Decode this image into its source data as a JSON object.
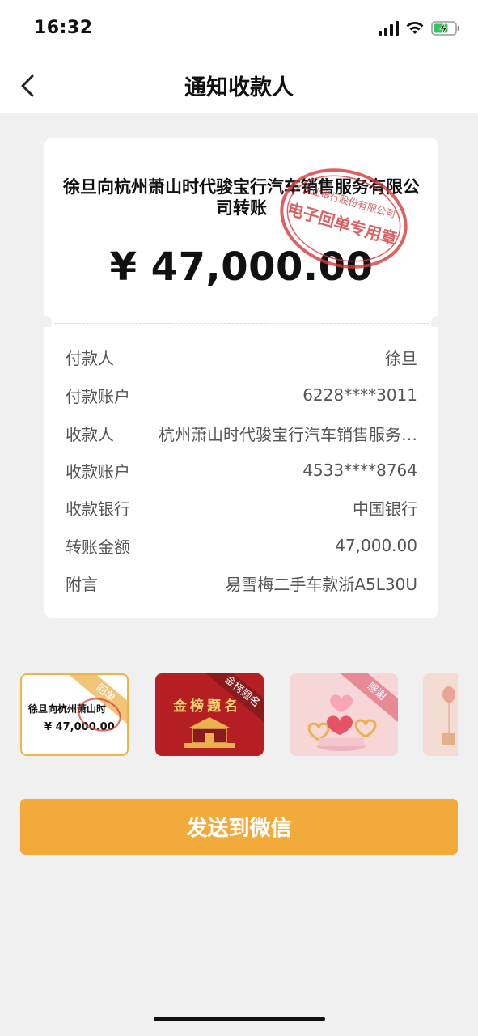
{
  "status_bar": {
    "time": "16:32"
  },
  "nav": {
    "title": "通知收款人"
  },
  "receipt": {
    "title": "徐旦向杭州萧山时代骏宝行汽车销售服务有限公司转账",
    "amount": "¥ 47,000.00",
    "stamp": {
      "line1": "电子回单专用章",
      "line2": "农业银行股份有限公司"
    },
    "rows": [
      {
        "label": "付款人",
        "value": "徐旦"
      },
      {
        "label": "付款账户",
        "value": "6228****3011"
      },
      {
        "label": "收款人",
        "value": "杭州萧山时代骏宝行汽车销售服务有限公司"
      },
      {
        "label": "收款账户",
        "value": "4533****8764"
      },
      {
        "label": "收款银行",
        "value": "中国银行"
      },
      {
        "label": "转账金额",
        "value": "47,000.00"
      },
      {
        "label": "附言",
        "value": "易雪梅二手车款浙A5L30U"
      }
    ]
  },
  "templates": [
    {
      "ribbon": "回单",
      "preview_title": "徐旦向杭州萧山时",
      "preview_amount": "¥ 47,000.00",
      "selected": true
    },
    {
      "ribbon": "金榜题名",
      "banner": "金榜题名"
    },
    {
      "ribbon": "感谢"
    },
    {
      "ribbon": ""
    }
  ],
  "actions": {
    "send_label": "发送到微信"
  },
  "colors": {
    "accent": "#f2ab3a",
    "stamp_red": "#d8393a",
    "selected_border": "#f0b445"
  }
}
